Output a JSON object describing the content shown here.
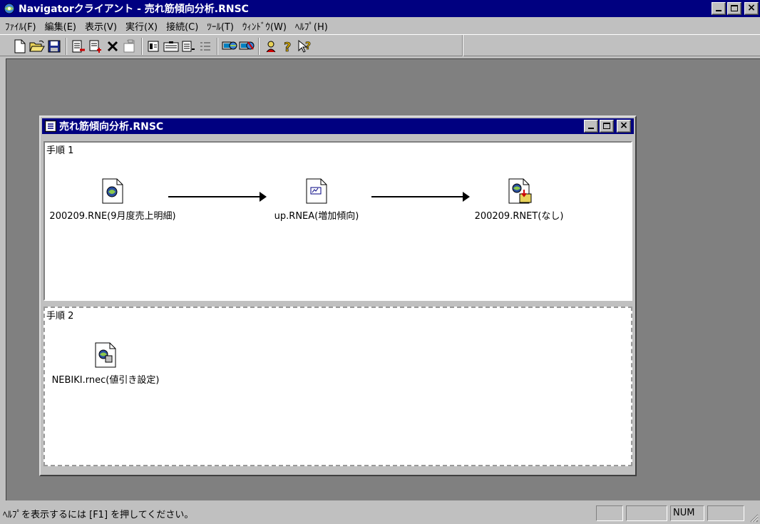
{
  "app": {
    "title": "Navigatorクライアント - 売れ筋傾向分析.RNSC",
    "icon": "navigator-app-icon"
  },
  "menu": [
    {
      "label": "ﾌｧｲﾙ(F)"
    },
    {
      "label": "編集(E)"
    },
    {
      "label": "表示(V)"
    },
    {
      "label": "実行(X)"
    },
    {
      "label": "接続(C)"
    },
    {
      "label": "ﾂｰﾙ(T)"
    },
    {
      "label": "ｳｨﾝﾄﾞｳ(W)"
    },
    {
      "label": "ﾍﾙﾌﾟ(H)"
    }
  ],
  "toolbar": {
    "icons": [
      "new-icon",
      "open-icon",
      "save-icon",
      "add-step-icon",
      "insert-step-icon",
      "delete-icon",
      "properties-icon",
      "execute-icon",
      "run-all-icon",
      "schedule-icon",
      "list-icon",
      "connect-icon",
      "disconnect-icon",
      "user-icon",
      "help-icon",
      "context-help-icon"
    ]
  },
  "child_window": {
    "title": "売れ筋傾向分析.RNSC",
    "steps": [
      {
        "label": "手順 1",
        "nodes": [
          {
            "caption": "200209.RNE(9月度売上明細)",
            "icon": "rne-file-icon"
          },
          {
            "caption": "up.RNEA(増加傾向)",
            "icon": "rnea-file-icon"
          },
          {
            "caption": "200209.RNET(なし)",
            "icon": "rnet-file-icon"
          }
        ]
      },
      {
        "label": "手順 2",
        "nodes": [
          {
            "caption": "NEBIKI.rnec(値引き設定)",
            "icon": "rnec-file-icon"
          }
        ]
      }
    ]
  },
  "status": {
    "text": "ﾍﾙﾌﾟを表示するには [F1] を押してください。",
    "panels": [
      "",
      "",
      "NUM",
      ""
    ]
  },
  "colors": {
    "titlebar": "#000080",
    "face": "#c0c0c0",
    "workspace": "#808080"
  }
}
